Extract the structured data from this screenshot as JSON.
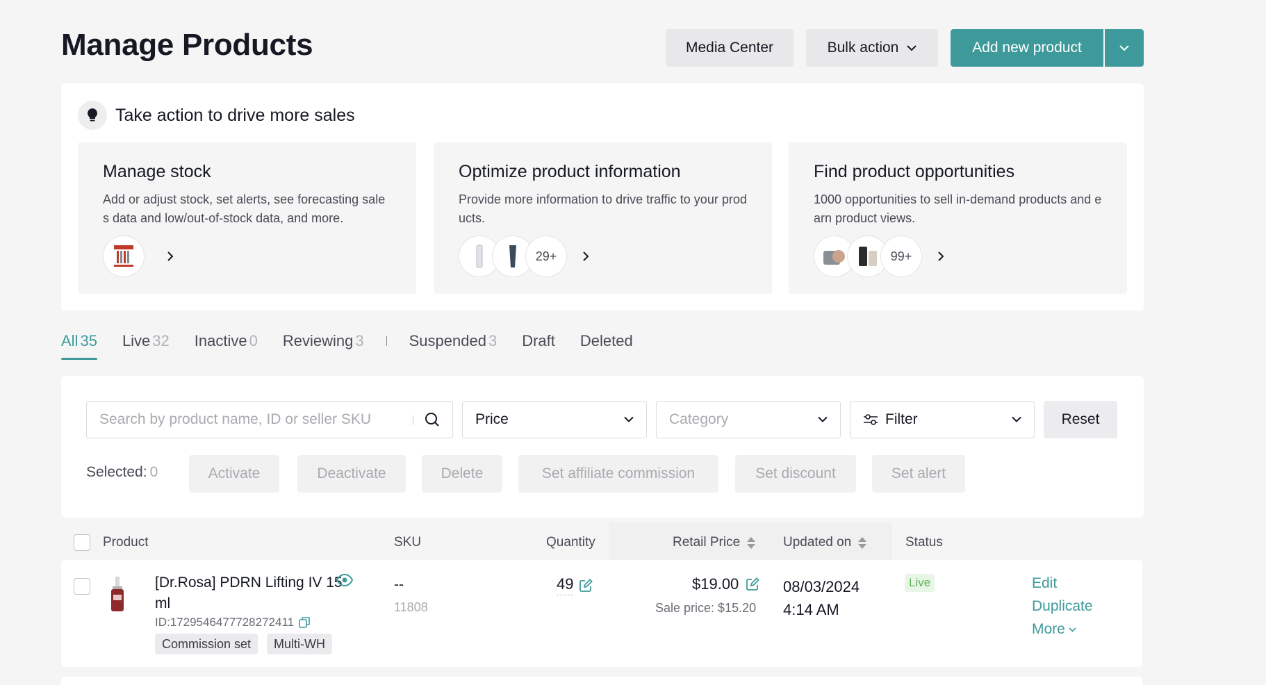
{
  "header": {
    "title": "Manage Products",
    "media_center": "Media Center",
    "bulk_action": "Bulk action",
    "add_new_product": "Add new product"
  },
  "insights": {
    "title": "Take action to drive more sales",
    "tiles": [
      {
        "title": "Manage stock",
        "description": "Add or adjust stock, set alerts, see forecasting sales data and low/out-of-stock data, and more.",
        "count": ""
      },
      {
        "title": "Optimize product information",
        "description": "Provide more information to drive traffic to your products.",
        "count": "29+"
      },
      {
        "title": "Find product opportunities",
        "description": "1000 opportunities to sell in-demand products and earn product views.",
        "count": "99+"
      }
    ]
  },
  "tabs": [
    {
      "label": "All",
      "count": "35"
    },
    {
      "label": "Live",
      "count": "32"
    },
    {
      "label": "Inactive",
      "count": "0"
    },
    {
      "label": "Reviewing",
      "count": "3"
    },
    {
      "label": "Suspended",
      "count": "3"
    },
    {
      "label": "Draft",
      "count": ""
    },
    {
      "label": "Deleted",
      "count": ""
    }
  ],
  "filters": {
    "search_placeholder": "Search by product name, ID or seller SKU",
    "price": "Price",
    "category_placeholder": "Category",
    "filter": "Filter",
    "reset": "Reset"
  },
  "selection": {
    "label": "Selected:",
    "count": "0",
    "actions": [
      "Activate",
      "Deactivate",
      "Delete",
      "Set affiliate commission",
      "Set discount",
      "Set alert"
    ]
  },
  "table": {
    "columns": {
      "product": "Product",
      "sku": "SKU",
      "quantity": "Quantity",
      "retail_price": "Retail Price",
      "updated_on": "Updated on",
      "status": "Status"
    },
    "rows": [
      {
        "name": "[Dr.Rosa] PDRN Lifting IV 15 ml",
        "id": "ID:1729546477728272411",
        "tags": [
          "Commission set",
          "Multi-WH"
        ],
        "sku": "--",
        "sku_sub": "11808",
        "quantity": "49",
        "price": "$19.00",
        "sale_price": "Sale price: $15.20",
        "updated_date": "08/03/2024",
        "updated_time": "4:14 AM",
        "status": "Live",
        "actions": {
          "edit": "Edit",
          "duplicate": "Duplicate",
          "more": "More"
        }
      }
    ]
  },
  "colors": {
    "accent": "#3e9a9a",
    "live_green": "#5fb25b",
    "background": "#f5f5f6"
  }
}
